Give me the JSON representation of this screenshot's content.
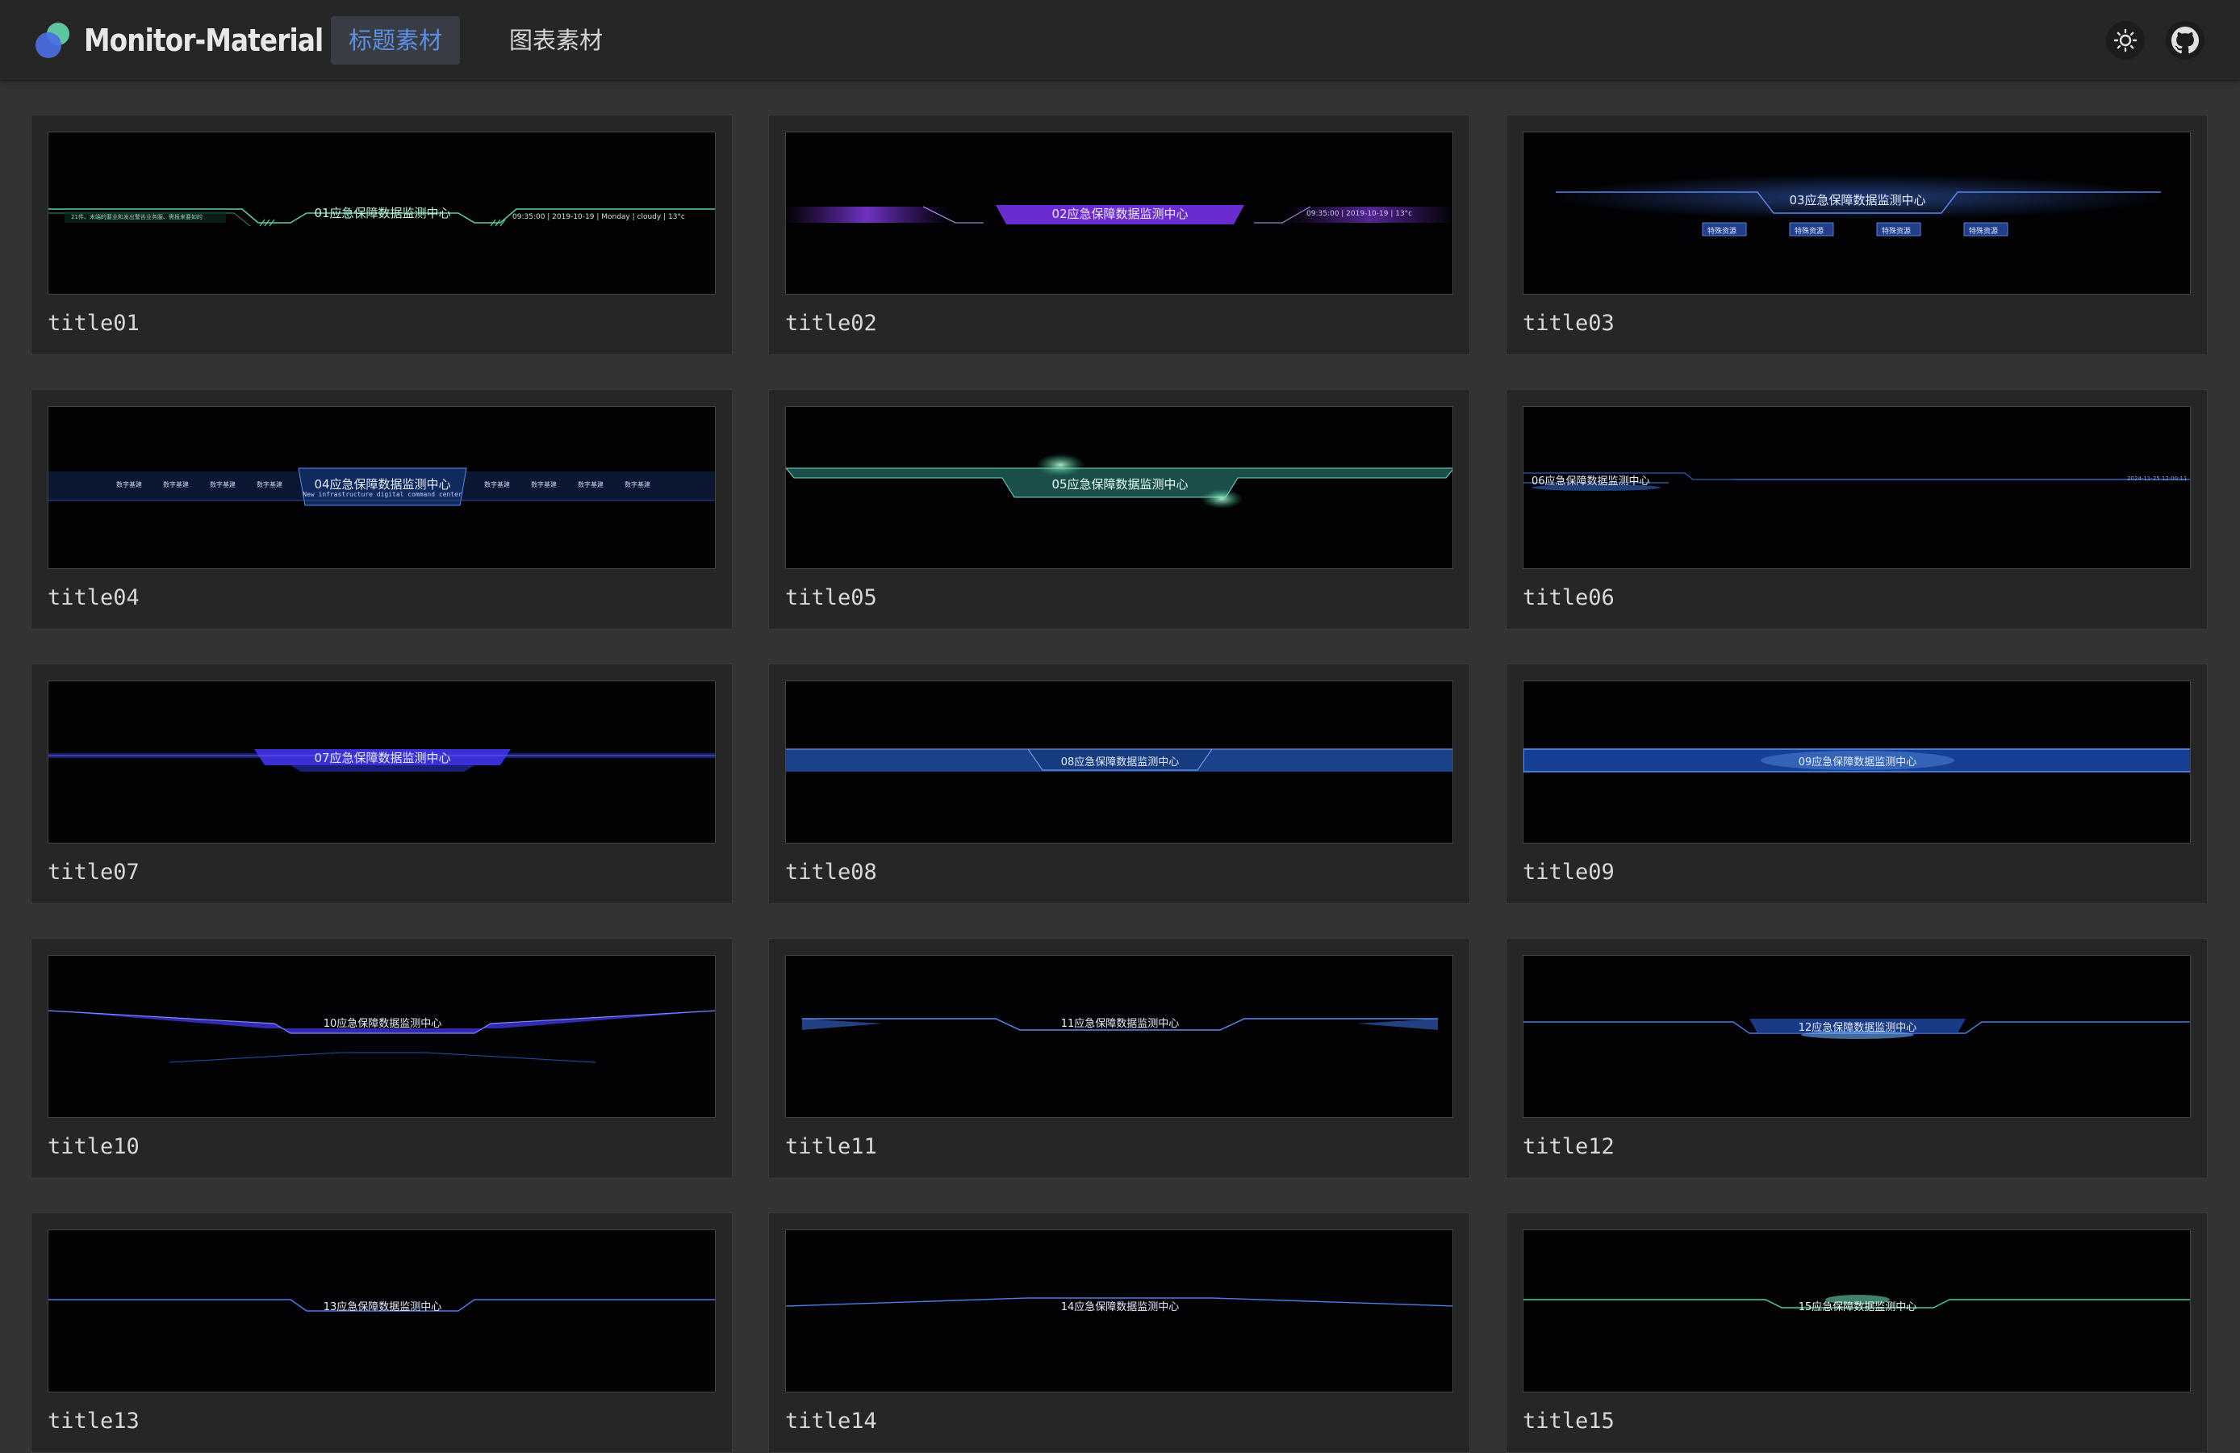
{
  "app": {
    "brand": "Monitor-Material",
    "tabs": [
      {
        "label": "标题素材",
        "active": true
      },
      {
        "label": "图表素材",
        "active": false
      }
    ],
    "accent_color": "#5b8fe6",
    "icons": {
      "theme": "sun-icon",
      "github": "github-icon"
    }
  },
  "cards": [
    {
      "label": "title01",
      "heading": "01应急保障数据监测中心",
      "left_info": "21件、末端的要业和发出警告业务服、需报来要如的",
      "right_info": "09:35:00 | 2019-10-19 | Monday | cloudy | 13°c"
    },
    {
      "label": "title02",
      "heading": "02应急保障数据监测中心",
      "right_info": "09:35:00 | 2019-10-19 | 13°c"
    },
    {
      "label": "title03",
      "heading": "03应急保障数据监测中心",
      "buttons": [
        "特殊资源",
        "特殊资源",
        "特殊资源",
        "特殊资源"
      ]
    },
    {
      "label": "title04",
      "heading": "04应急保障数据监测中心",
      "subheading": "New infrastructure digital command center",
      "left_menu": [
        "数字基建",
        "数字基建",
        "数字基建",
        "数字基建"
      ],
      "right_menu": [
        "数字基建",
        "数字基建",
        "数字基建",
        "数字基建"
      ]
    },
    {
      "label": "title05",
      "heading": "05应急保障数据监测中心"
    },
    {
      "label": "title06",
      "heading": "06应急保障数据监测中心",
      "right_info": "2024-11-25 12:00:11"
    },
    {
      "label": "title07",
      "heading": "07应急保障数据监测中心"
    },
    {
      "label": "title08",
      "heading": "08应急保障数据监测中心"
    },
    {
      "label": "title09",
      "heading": "09应急保障数据监测中心"
    },
    {
      "label": "title10",
      "heading": "10应急保障数据监测中心"
    },
    {
      "label": "title11",
      "heading": "11应急保障数据监测中心"
    },
    {
      "label": "title12",
      "heading": "12应急保障数据监测中心"
    },
    {
      "label": "title13",
      "heading": "13应急保障数据监测中心"
    },
    {
      "label": "title14",
      "heading": "14应急保障数据监测中心"
    },
    {
      "label": "title15",
      "heading": "15应急保障数据监测中心"
    }
  ]
}
